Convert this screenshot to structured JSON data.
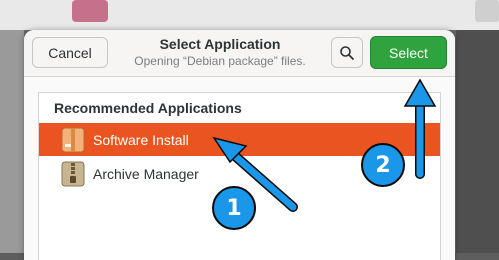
{
  "colors": {
    "accent_orange": "#e95420",
    "select_green": "#2ea33e",
    "annotation_blue": "#1a97e8"
  },
  "dialog": {
    "title": "Select Application",
    "subtitle": "Opening “Debian package” files.",
    "cancel_label": "Cancel",
    "select_label": "Select",
    "search_icon": "search-icon"
  },
  "list": {
    "heading": "Recommended Applications",
    "items": [
      {
        "label": "Software Install",
        "icon": "package-icon",
        "selected": true
      },
      {
        "label": "Archive Manager",
        "icon": "zip-archive-icon",
        "selected": false
      }
    ]
  },
  "annotations": {
    "step1": "1",
    "step2": "2"
  }
}
